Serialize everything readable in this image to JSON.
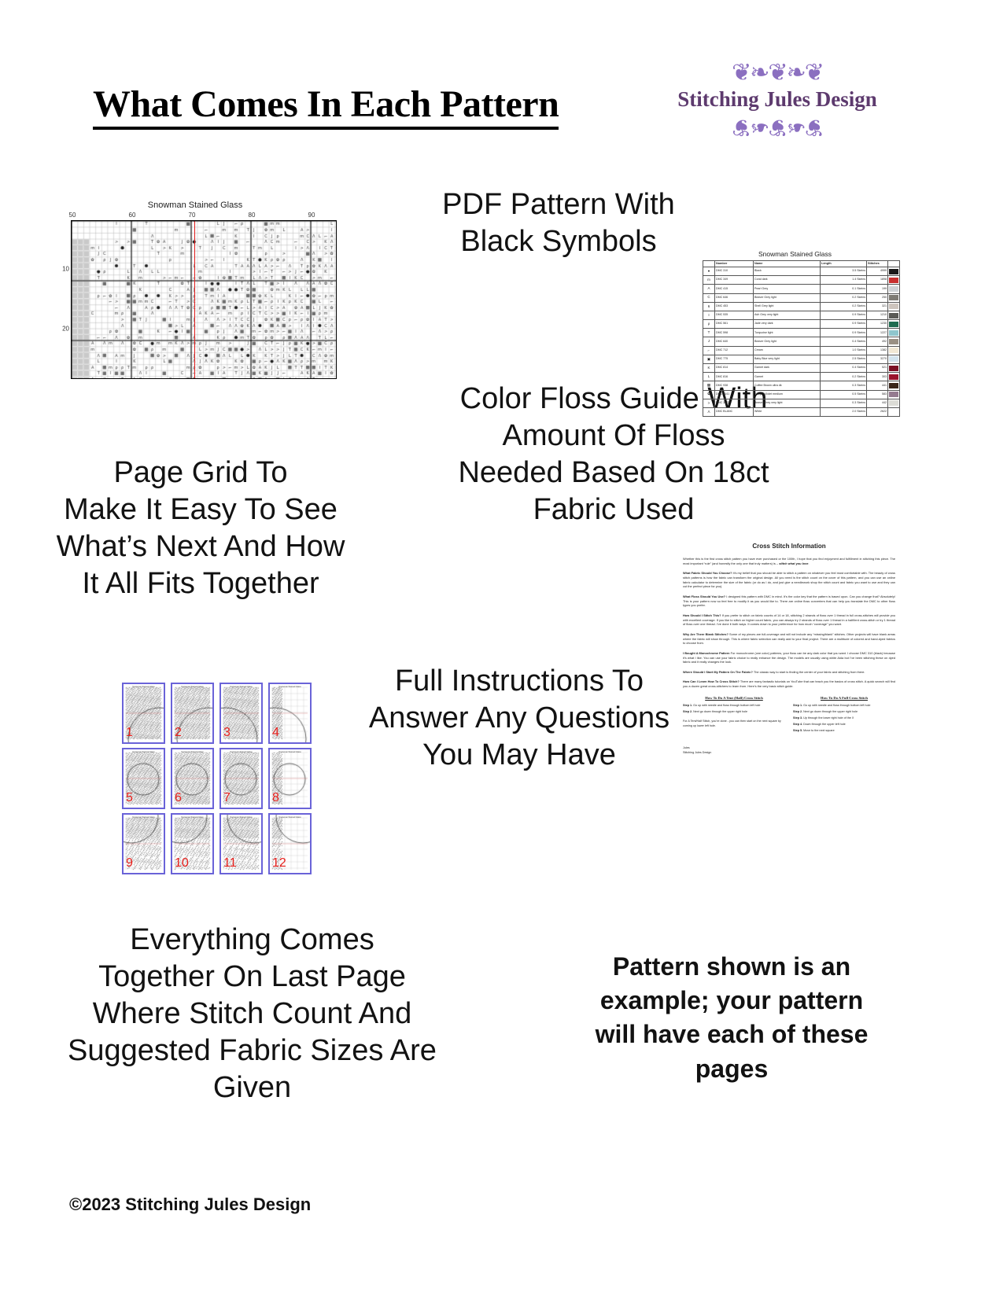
{
  "header": {
    "title": "What Comes In Each Pattern",
    "logo_brand": "Stitching Jules Design",
    "logo_flourish_color": "#8b6fc0",
    "logo_text_color": "#5d3a6e"
  },
  "copy": {
    "pdf_pattern": "PDF Pattern With\nBlack Symbols",
    "page_grid": "Page Grid To\nMake It Easy To See\nWhat’s Next And How\nIt All Fits Together",
    "color_floss": "Color Floss Guide With\nAmount Of Floss\nNeeded Based On 18ct\nFabric Used",
    "instructions": "Full Instructions To\nAnswer Any Questions\nYou May Have",
    "everything": "Everything Comes\nTogether On Last Page\nWhere Stitch Count And\nSuggested Fabric Sizes Are\nGiven",
    "note": "Pattern shown is an example; your pattern will have each of these pages",
    "copyright": "©2023 Stitching Jules Design"
  },
  "chart": {
    "title": "Snowman Stained Glass",
    "column_labels": [
      "50",
      "60",
      "70",
      "80",
      "90"
    ],
    "row_labels": [
      "10",
      "20"
    ],
    "center_line_color": "#e01b1b"
  },
  "floss_table": {
    "title": "Snowman Stained Glass",
    "columns": [
      "",
      "Number",
      "Name",
      "Length",
      "Stitches",
      ""
    ],
    "rows": [
      {
        "symbol": "●",
        "number": "DMC   310",
        "name": "Black",
        "length": "3.5 Skeins",
        "stitches": "4999",
        "color": "#1a1a1a"
      },
      {
        "symbol": "m",
        "number": "DMC   349",
        "name": "Coral dark",
        "length": "1.4 Skeins",
        "stitches": "1898",
        "color": "#c8302f"
      },
      {
        "symbol": "A",
        "number": "DMC   415",
        "name": "Pearl Grey",
        "length": "0.1 Skeins",
        "stitches": "199",
        "color": "#cfd3d6"
      },
      {
        "symbol": "C",
        "number": "DMC   646",
        "name": "Beaver Grey light",
        "length": "0.2 Skeins",
        "stitches": "250",
        "color": "#7e7b74"
      },
      {
        "symbol": "6",
        "number": "DMC   453",
        "name": "Shell Grey light",
        "length": "0.2 Skeins",
        "stitches": "321",
        "color": "#cdc4bd"
      },
      {
        "symbol": "I",
        "number": "DMC   535",
        "name": "Ash Grey very light",
        "length": "0.9 Skeins",
        "stitches": "1210",
        "color": "#5a5a56"
      },
      {
        "symbol": "ρ",
        "number": "DMC   561",
        "name": "Jade very dark",
        "length": "0.9 Skeins",
        "stitches": "1230",
        "color": "#1f6b4f"
      },
      {
        "symbol": "T",
        "number": "DMC   598",
        "name": "Turquoise light",
        "length": "0.9 Skeins",
        "stitches": "1227",
        "color": "#8fc6cd"
      },
      {
        "symbol": "J",
        "number": "DMC   640",
        "name": "Beaver Grey light",
        "length": "0.4 Skeins",
        "stitches": "492",
        "color": "#9a9084"
      },
      {
        "symbol": "⌐",
        "number": "DMC   712",
        "name": "Cream",
        "length": "1.0 Skeins",
        "stitches": "1382",
        "color": "#f2e8d5"
      },
      {
        "symbol": "▣",
        "number": "DMC   775",
        "name": "Baby Blue very light",
        "length": "2.5 Skeins",
        "stitches": "3270",
        "color": "#d3e4ef"
      },
      {
        "symbol": "K",
        "number": "DMC   814",
        "name": "Garnet dark",
        "length": "0.4 Skeins",
        "stitches": "521",
        "color": "#7b1024"
      },
      {
        "symbol": "L",
        "number": "DMC   816",
        "name": "Garnet",
        "length": "0.2 Skeins",
        "stitches": "303",
        "color": "#9a132b"
      },
      {
        "symbol": "▩",
        "number": "DMC   938",
        "name": "Coffee Brown ultra dk",
        "length": "0.3 Skeins",
        "stitches": "441",
        "color": "#3a2519"
      },
      {
        "symbol": "✿",
        "number": "DMC   3041",
        "name": "Antique Violet medium",
        "length": "0.5 Skeins",
        "stitches": "583",
        "color": "#957b90"
      },
      {
        "symbol": ">",
        "number": "DMC   3072",
        "name": "Beaver Grey very light",
        "length": "0.3 Skeins",
        "stitches": "442",
        "color": "#dcdcd6"
      },
      {
        "symbol": "Λ",
        "number": "DMC   BLANC",
        "name": "White",
        "length": "2.0 Skeins",
        "stitches": "2622",
        "color": "#ffffff"
      }
    ]
  },
  "page_grid": {
    "thumbnail_title": "Snowman Stained Glass",
    "numbers": [
      "1",
      "2",
      "3",
      "4",
      "5",
      "6",
      "7",
      "8",
      "9",
      "10",
      "11",
      "12"
    ],
    "border_color": "#6a63d8",
    "number_color": "#e8201c"
  },
  "instructions": {
    "heading": "Cross Stitch Information",
    "paragraphs": [
      "Whether this is the first cross stitch pattern you have ever purchased or the 100th, I hope that you find enjoyment and fulfillment in stitching this piece. The most important “rule” (and honestly the only one that truly matters) is – stitch what you love.",
      "What Fabric Should You Choose? It’s my belief that you should be able to stitch a pattern on whatever you feel most comfortable with. The beauty of cross stitch patterns is how the fabric can transform the original design. All you need is the stitch count on the cover of this pattern, and you can use an online fabric calculator to determine the size of the fabric (or do as I do, and just give a needlework shop the stitch count and fabric you want to use and they can cut the perfect piece for you).",
      "What Floss Should You Use? I designed this pattern with DMC in mind. It’s the color key that the pattern is based upon. Can you change that? Absolutely! This is your pattern now so feel free to modify it as you would like to. There are online floss converters that can help you translate the DMC to other floss types you prefer.",
      "How Should I Stitch This? If you prefer to stitch on fabric counts of 14 or 18, stitching 2 strands of floss over 1 thread in full cross-stitches will provide you with excellent coverage. If you like to stitch on higher count fabric, you can always try 2 strands of floss over 1 thread in a half/tent cross-stitch or try 1 thread of floss over one thread. I’ve done it both ways. It comes down to your preference for how much “coverage” you want.",
      "Why Are There Blank Stitches? Some of my pieces are full-coverage and will not include any “missing/blank” stitches. Other projects will have blank areas where the fabric will show through. This is where fabric selection can really add to your final project. There are a multitude of colored and hand-dyed fabrics to choose from.",
      "I Bought A Monochrome Pattern For monochrome (one color) patterns, your floss can be any dark color that you want. I choose DMC 310 (black) because it’s what I like. You can use your fabric choice to really enhance the design. The models are usually using white Aida but I’ve been stitching these on dyed fabric and it really changes the look.",
      "Where Should I Start My Pattern On The Fabric? The classic way to start is finding the center of your fabric and stitching from there.",
      "How Can I Learn How To Cross Stitch? There are many fantastic tutorials on YouTube that can teach you the basics of cross stitch. A quick search will find you a dozen great cross-stitchers to learn from. Here’s the very basic stitch guide."
    ],
    "howto_half": {
      "heading": "How To Do A Tent (Half) Cross Stitch",
      "steps": [
        "Step 1. Go up with needle and floss through bottom left hole",
        "Step 2. Next go down through the upper right hole"
      ],
      "note": "For A Tent/Half Stitch, you’re done - you can then start on the next square by coming up lower left hole."
    },
    "howto_full": {
      "heading": "How To Do A Full Cross Stitch",
      "steps": [
        "Step 1. Go up with needle and floss through bottom left hole",
        "Step 2. Next go down through the upper right hole",
        "Step 3. Up through the lower right hole of the X",
        "Step 4. Down through the upper left hole",
        "Step 5. Move to the next square"
      ]
    },
    "signature_line1": "Jules",
    "signature_line2": "Stitching Jules Design"
  }
}
